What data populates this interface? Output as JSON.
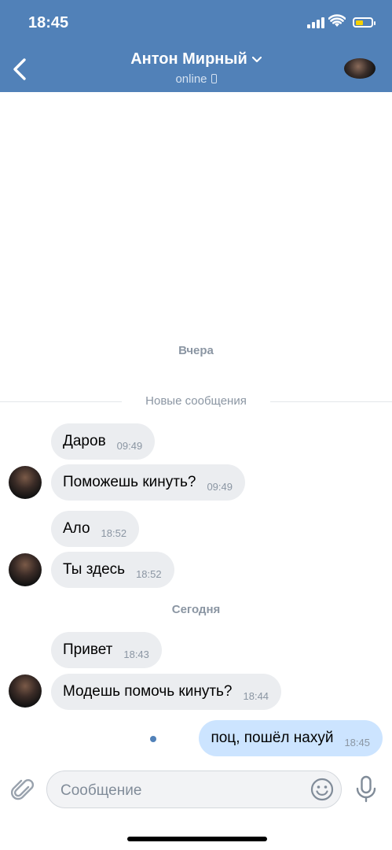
{
  "status_bar": {
    "time": "18:45"
  },
  "header": {
    "name": "Антон Мирный",
    "status": "online"
  },
  "day_separators": {
    "yesterday": "Вчера",
    "today": "Сегодня"
  },
  "new_messages_label": "Новые сообщения",
  "messages": [
    {
      "text": "Даров",
      "time": "09:49"
    },
    {
      "text": "Поможешь кинуть?",
      "time": "09:49"
    },
    {
      "text": "Ало",
      "time": "18:52"
    },
    {
      "text": "Ты здесь",
      "time": "18:52"
    },
    {
      "text": "Привет",
      "time": "18:43"
    },
    {
      "text": "Модешь помочь кинуть?",
      "time": "18:44"
    },
    {
      "text": "поц, пошёл нахуй",
      "time": "18:45"
    }
  ],
  "composer": {
    "placeholder": "Сообщение"
  },
  "colors": {
    "header": "#5181b8",
    "incoming_bubble": "#ebedf0",
    "outgoing_bubble": "#cce4ff",
    "muted": "#8b96a3"
  },
  "icons": [
    "back-chevron-icon",
    "chevron-down-icon",
    "phone-icon",
    "attach-clip-icon",
    "smile-icon",
    "microphone-icon",
    "signal-icon",
    "wifi-icon",
    "battery-icon"
  ]
}
